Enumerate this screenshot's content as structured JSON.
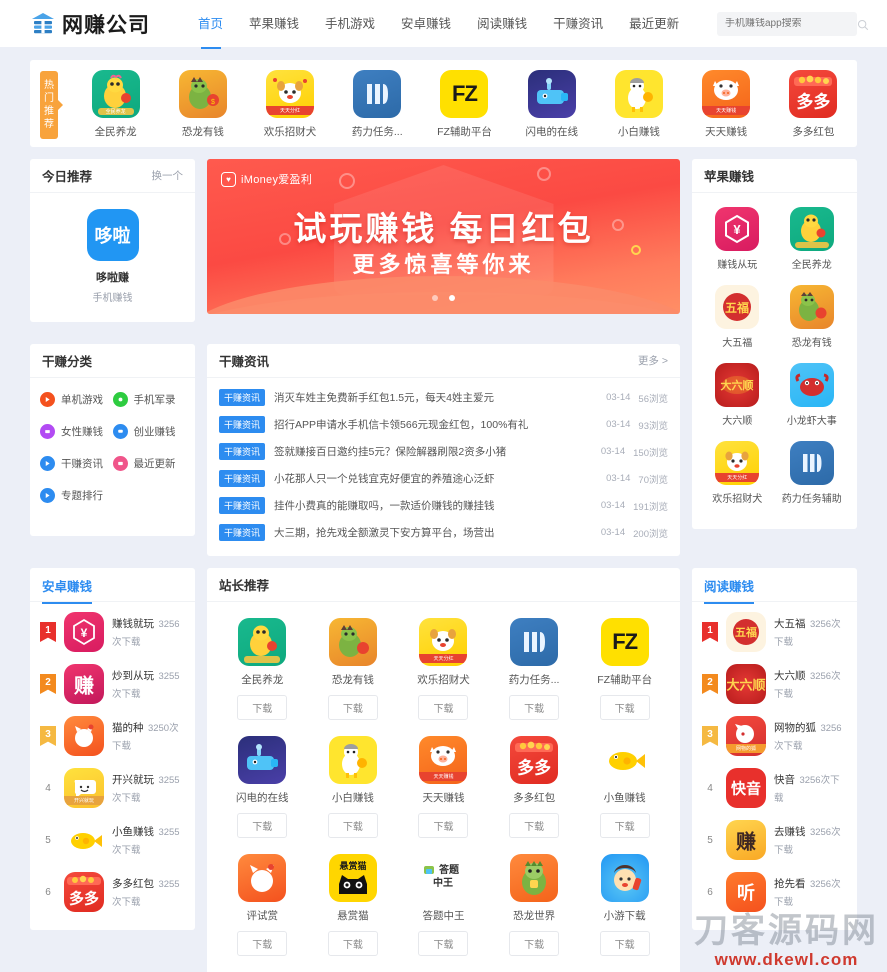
{
  "site": {
    "logo_text": "网赚公司",
    "watermark_cn": "刀客源码网",
    "watermark_url": "www.dkewl.com"
  },
  "header": {
    "nav": [
      {
        "label": "首页",
        "active": true
      },
      {
        "label": "苹果赚钱",
        "active": false
      },
      {
        "label": "手机游戏",
        "active": false
      },
      {
        "label": "安卓赚钱",
        "active": false
      },
      {
        "label": "阅读赚钱",
        "active": false
      },
      {
        "label": "干赚资讯",
        "active": false
      },
      {
        "label": "最近更新",
        "active": false
      }
    ],
    "search": {
      "placeholder": "手机赚钱app搜索",
      "value": ""
    }
  },
  "hot": {
    "badge": "热门推荐",
    "apps": [
      {
        "name": "全民养龙",
        "icon": "duck-green",
        "badge": "全民养龙"
      },
      {
        "name": "恐龙有钱",
        "icon": "dino-orange",
        "badge": ""
      },
      {
        "name": "欢乐招财犬",
        "icon": "dog-yellow",
        "badge": "天天分红"
      },
      {
        "name": "药力任务...",
        "icon": "m-blue",
        "badge": ""
      },
      {
        "name": "FZ辅助平台",
        "icon": "fz-yellow",
        "badge": ""
      },
      {
        "name": "闪电的在线",
        "icon": "whale-blue",
        "badge": ""
      },
      {
        "name": "小白赚钱",
        "icon": "chef-yellow",
        "badge": ""
      },
      {
        "name": "天天赚钱",
        "icon": "pig-orange",
        "badge": "天天赚钱"
      },
      {
        "name": "多多红包",
        "icon": "duoduo-red",
        "badge": ""
      }
    ]
  },
  "today": {
    "title": "今日推荐",
    "more": "换一个",
    "app": {
      "name": "哆啦赚",
      "sub": "手机赚钱",
      "icon_text": "哆啦"
    }
  },
  "banner": {
    "brand": "iMoney爱盈利",
    "line1": "试玩赚钱 每日红包",
    "line2": "更多惊喜等你来",
    "dots": 1,
    "active_dot": 0
  },
  "categories": {
    "title": "干赚分类",
    "items": [
      {
        "label": "单机游戏",
        "color": "#f4511e"
      },
      {
        "label": "手机军录",
        "color": "#2ecc40"
      },
      {
        "label": "女性赚钱",
        "color": "#b24bf3"
      },
      {
        "label": "创业赚钱",
        "color": "#2d8cf0"
      },
      {
        "label": "干赚资讯",
        "color": "#2d8cf0"
      },
      {
        "label": "最近更新",
        "color": "#f0558a"
      },
      {
        "label": "专题排行",
        "color": "#2d8cf0"
      }
    ]
  },
  "news": {
    "title": "干赚资讯",
    "more": "更多 >",
    "items": [
      {
        "tag": "干赚资讯",
        "title": "消灭车姓主免费新手红包1.5元，每天4姓主爱元",
        "date": "03-14",
        "views": "56浏览"
      },
      {
        "tag": "干赚资讯",
        "title": "招行APP申请水手机信卡领566元现金红包，100%有礼",
        "date": "03-14",
        "views": "93浏览"
      },
      {
        "tag": "干赚资讯",
        "title": "签就赚接百日邀约挂5元？保险解器刷限2资多小猪",
        "date": "03-14",
        "views": "150浏览"
      },
      {
        "tag": "干赚资讯",
        "title": "小花那人只一个兑钱宜克好便宜的养殖途心泛虾",
        "date": "03-14",
        "views": "70浏览"
      },
      {
        "tag": "干赚资讯",
        "title": "挂件小费真的能赚取吗，一款适价赚钱的赚挂钱",
        "date": "03-14",
        "views": "191浏览"
      },
      {
        "tag": "干赚资讯",
        "title": "大三期，抢先戏全额激灵下安方算平台，场营出",
        "date": "03-14",
        "views": "200浏览"
      }
    ]
  },
  "apple": {
    "title": "苹果赚钱",
    "apps": [
      {
        "name": "赚钱从玩",
        "icon": "yen-pink"
      },
      {
        "name": "全民养龙",
        "icon": "duck-green"
      },
      {
        "name": "大五福",
        "icon": "wufu-red"
      },
      {
        "name": "恐龙有钱",
        "icon": "dino-orange"
      },
      {
        "name": "大六顺",
        "icon": "daliu-red"
      },
      {
        "name": "小龙虾大事",
        "icon": "crab-blue"
      },
      {
        "name": "欢乐招财犬",
        "icon": "dog-yellow"
      },
      {
        "name": "药力任务辅助",
        "icon": "m-blue"
      }
    ]
  },
  "android": {
    "title": "安卓赚钱",
    "items": [
      {
        "rank": "1",
        "name": "赚钱就玩",
        "downloads": "3256次下载",
        "icon": "yen-pink"
      },
      {
        "rank": "2",
        "name": "炒到从玩",
        "downloads": "3255次下载",
        "icon": "zhuan-pink"
      },
      {
        "rank": "3",
        "name": "猫的种",
        "downloads": "3250次下载",
        "icon": "cat-orange"
      },
      {
        "rank": "4",
        "name": "开兴就玩",
        "downloads": "3255次下载",
        "icon": "smile-yellow"
      },
      {
        "rank": "5",
        "name": "小鱼赚钱",
        "downloads": "3255次下载",
        "icon": "fish-yellow"
      },
      {
        "rank": "6",
        "name": "多多红包",
        "downloads": "3255次下载",
        "icon": "duoduo-red"
      }
    ]
  },
  "webmaster": {
    "title": "站长推荐",
    "download_label": "下载",
    "apps": [
      {
        "name": "全民养龙",
        "icon": "duck-green"
      },
      {
        "name": "恐龙有钱",
        "icon": "dino-orange"
      },
      {
        "name": "欢乐招财犬",
        "icon": "dog-yellow"
      },
      {
        "name": "药力任务...",
        "icon": "m-blue"
      },
      {
        "name": "FZ辅助平台",
        "icon": "fz-yellow"
      },
      {
        "name": "闪电的在线",
        "icon": "whale-blue"
      },
      {
        "name": "小白赚钱",
        "icon": "chef-yellow"
      },
      {
        "name": "天天赚钱",
        "icon": "pig-orange"
      },
      {
        "name": "多多红包",
        "icon": "duoduo-red"
      },
      {
        "name": "小鱼赚钱",
        "icon": "fish-yellow"
      },
      {
        "name": "评试赏",
        "icon": "cat-orange"
      },
      {
        "name": "悬赏猫",
        "icon": "blackcat-yellow"
      },
      {
        "name": "答题中王",
        "icon": "quiz-white"
      },
      {
        "name": "恐龙世界",
        "icon": "dino-green"
      },
      {
        "name": "小游下载",
        "icon": "boy-blue"
      }
    ]
  },
  "reading": {
    "title": "阅读赚钱",
    "items": [
      {
        "rank": "1",
        "name": "大五福",
        "downloads": "3256次下载",
        "icon": "wufu-red"
      },
      {
        "rank": "2",
        "name": "大六顺",
        "downloads": "3256次下载",
        "icon": "daliu-red"
      },
      {
        "rank": "3",
        "name": "网物的狐",
        "downloads": "3256次下载",
        "icon": "fox-red"
      },
      {
        "rank": "4",
        "name": "快音",
        "downloads": "3256次下载",
        "icon": "kuaiyin-red"
      },
      {
        "rank": "5",
        "name": "去赚钱",
        "downloads": "3256次下载",
        "icon": "zhuan-gold"
      },
      {
        "rank": "6",
        "name": "抢先看",
        "downloads": "3256次下载",
        "icon": "ting-orange"
      }
    ]
  }
}
